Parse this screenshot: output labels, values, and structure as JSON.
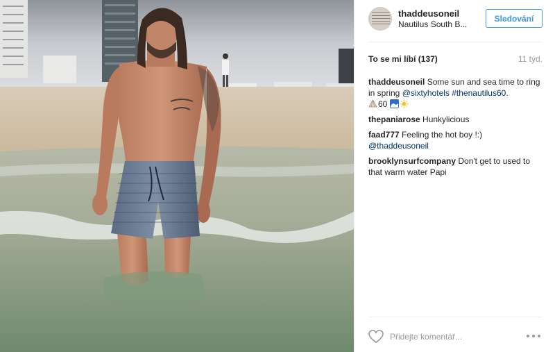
{
  "post": {
    "username": "thaddeusoneil",
    "location": "Nautilus South B...",
    "avatar_text": "THADDEUS O'NEIL",
    "follow_label": "Sledování",
    "likes_label": "To se mi líbí (137)",
    "time_label": "11 týd.",
    "colors": {
      "accent": "#3897f0",
      "link": "#003569",
      "muted": "#999999"
    }
  },
  "comments": [
    {
      "user": "thaddeusoneil",
      "text_1": "Some sun and sea time to ring in spring",
      "tag_1": "@sixtyhotels",
      "tag_2": "#thenautilus60",
      "dot": ".",
      "count": "60",
      "emojis": [
        "shell-icon",
        "wave-icon",
        "sun-icon"
      ]
    },
    {
      "user": "thepaniarose",
      "text": "Hunkylicious"
    },
    {
      "user": "faad777",
      "text": "Feeling the hot boy !:)",
      "mention": "@thaddeusoneil"
    },
    {
      "user": "brooklynsurfcompany",
      "text": "Don't get to used to that warm water Papi"
    }
  ],
  "actions": {
    "comment_placeholder": "Přidejte komentář...",
    "icons": [
      "heart-icon",
      "more-options-icon"
    ]
  }
}
